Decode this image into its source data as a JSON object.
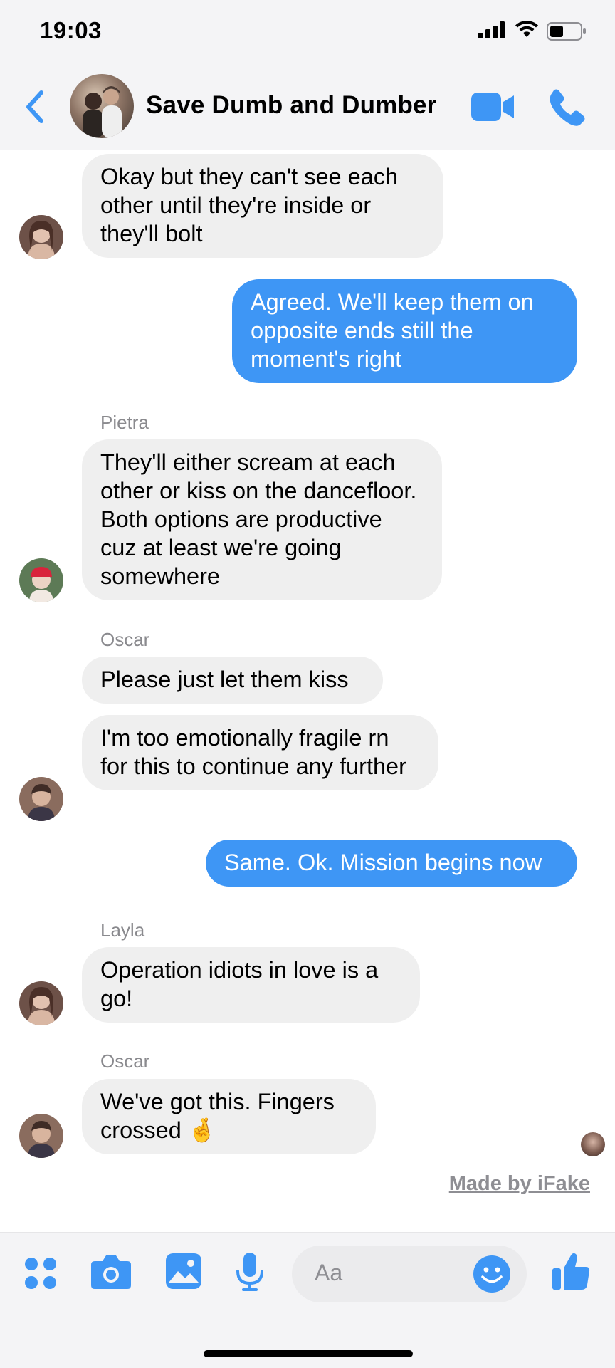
{
  "status": {
    "time": "19:03"
  },
  "header": {
    "title": "Save Dumb and Dumber"
  },
  "messages": [
    {
      "text": "Okay but they can't see each other until they're inside or they'll bolt"
    },
    {
      "text": "Agreed. We'll keep them on opposite ends still the moment's right"
    },
    {
      "sender": "Pietra",
      "text": "They'll either scream at each other or kiss on the dancefloor. Both options are productive cuz at least we're going somewhere"
    },
    {
      "sender": "Oscar",
      "text": "Please just let them kiss"
    },
    {
      "text": "I'm too emotionally fragile rn for this to continue any further"
    },
    {
      "text": "Same. Ok. Mission begins now"
    },
    {
      "sender": "Layla",
      "text": "Operation idiots in love is a go!"
    },
    {
      "sender": "Oscar",
      "text": "We've got this. Fingers crossed",
      "emoji": "🤞"
    }
  ],
  "watermark": "Made by iFake",
  "composer": {
    "placeholder": "Aa"
  },
  "icons": [
    "back-chevron-icon",
    "video-call-icon",
    "phone-icon",
    "apps-icon",
    "camera-icon",
    "gallery-icon",
    "microphone-icon",
    "emoji-icon",
    "thumbs-up-icon"
  ],
  "colors": {
    "accent": "#3e96f5",
    "incoming_bubble": "#efefef",
    "outgoing_bubble": "#3e96f5"
  }
}
